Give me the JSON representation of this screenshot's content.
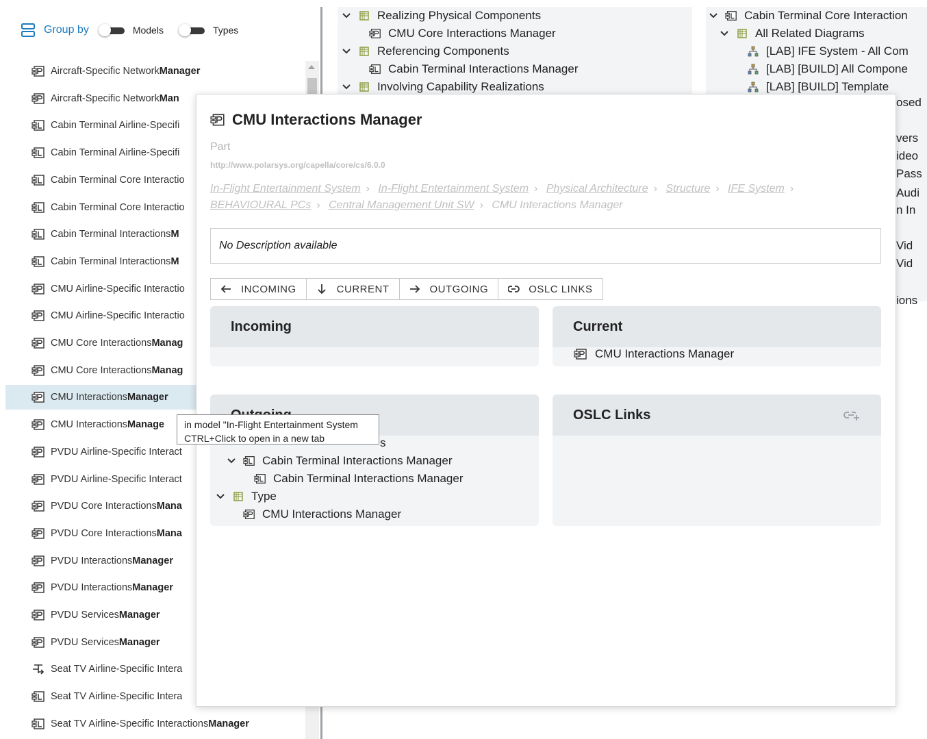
{
  "left_panel": {
    "group_by_label": "Group by",
    "models_label": "Models",
    "types_label": "Types",
    "items": [
      {
        "text": "Aircraft-Specific Network ",
        "bold": "Manager",
        "icon": "physical-component-icon"
      },
      {
        "text": "Aircraft-Specific Network ",
        "bold": "Man",
        "icon": "physical-component-icon"
      },
      {
        "text": "Cabin Terminal Airline-Specifi",
        "bold": "",
        "icon": "logical-component-icon"
      },
      {
        "text": "Cabin Terminal Airline-Specifi",
        "bold": "",
        "icon": "logical-component-icon"
      },
      {
        "text": "Cabin Terminal Core Interactio",
        "bold": "",
        "icon": "logical-component-icon"
      },
      {
        "text": "Cabin Terminal Core Interactio",
        "bold": "",
        "icon": "logical-component-icon"
      },
      {
        "text": "Cabin Terminal Interactions ",
        "bold": "M",
        "icon": "logical-component-icon"
      },
      {
        "text": "Cabin Terminal Interactions ",
        "bold": "M",
        "icon": "logical-component-icon"
      },
      {
        "text": "CMU Airline-Specific Interactio",
        "bold": "",
        "icon": "physical-component-icon"
      },
      {
        "text": "CMU Airline-Specific Interactio",
        "bold": "",
        "icon": "physical-component-icon"
      },
      {
        "text": "CMU Core Interactions ",
        "bold": "Manag",
        "icon": "physical-component-icon"
      },
      {
        "text": "CMU Core Interactions ",
        "bold": "Manag",
        "icon": "physical-component-icon"
      },
      {
        "text": "CMU Interactions ",
        "bold": "Manager",
        "icon": "physical-component-icon",
        "selected": true
      },
      {
        "text": "CMU Interactions ",
        "bold": "Manage",
        "icon": "physical-component-icon"
      },
      {
        "text": "PVDU Airline-Specific Interact",
        "bold": "",
        "icon": "physical-component-icon"
      },
      {
        "text": "PVDU Airline-Specific Interact",
        "bold": "",
        "icon": "physical-component-icon"
      },
      {
        "text": "PVDU Core Interactions ",
        "bold": "Mana",
        "icon": "physical-component-icon"
      },
      {
        "text": "PVDU Core Interactions ",
        "bold": "Mana",
        "icon": "physical-component-icon"
      },
      {
        "text": "PVDU Interactions ",
        "bold": "Manager",
        "icon": "physical-component-icon"
      },
      {
        "text": "PVDU Interactions ",
        "bold": "Manager",
        "icon": "physical-component-icon"
      },
      {
        "text": "PVDU Services ",
        "bold": "Manager",
        "icon": "physical-component-icon"
      },
      {
        "text": "PVDU Services ",
        "bold": "Manager",
        "icon": "physical-component-icon"
      },
      {
        "text": "Seat TV Airline-Specific Intera",
        "bold": "",
        "icon": "function-icon"
      },
      {
        "text": "Seat TV Airline-Specific Intera",
        "bold": "",
        "icon": "logical-component-icon"
      },
      {
        "text": "Seat TV Airline-Specific Interactions ",
        "bold": "Manager",
        "icon": "logical-component-icon"
      }
    ]
  },
  "bg_middle": {
    "lines": [
      {
        "text": "Realizing Physical Components",
        "icon": "package-icon",
        "chevron": true,
        "indent": 0
      },
      {
        "text": "CMU Core Interactions Manager",
        "icon": "physical-component-icon",
        "chevron": false,
        "indent": 1
      },
      {
        "text": "Referencing Components",
        "icon": "package-icon",
        "chevron": true,
        "indent": 0
      },
      {
        "text": "Cabin Terminal Interactions Manager",
        "icon": "logical-component-icon",
        "chevron": false,
        "indent": 1
      },
      {
        "text": "Involving Capability Realizations",
        "icon": "package-icon",
        "chevron": true,
        "indent": 0
      }
    ]
  },
  "bg_right": {
    "lines": [
      {
        "text": "Cabin Terminal Core Interaction",
        "icon": "logical-component-icon",
        "chevron": true,
        "indent": 0
      },
      {
        "text": "All Related Diagrams",
        "icon": "package-icon",
        "chevron": true,
        "indent": 1
      },
      {
        "text": "[LAB] IFE System - All Com",
        "icon": "diagram-icon",
        "chevron": false,
        "indent": 2
      },
      {
        "text": "[LAB] [BUILD] All Compone",
        "icon": "diagram-icon",
        "chevron": false,
        "indent": 2
      },
      {
        "text": "[LAB] [BUILD] Template",
        "icon": "diagram-icon",
        "chevron": false,
        "indent": 2
      }
    ],
    "fragments": [
      "osed",
      "vers",
      "ideo",
      "Pass",
      "Audi",
      "n In",
      "Vid",
      "Vid",
      "ions"
    ]
  },
  "popup": {
    "title": "CMU Interactions Manager",
    "type": "Part",
    "uri": "http://www.polarsys.org/capella/core/cs/6.0.0",
    "breadcrumbs": [
      "In-Flight Entertainment System",
      "In-Flight Entertainment System",
      "Physical Architecture",
      "Structure",
      "IFE System",
      "BEHAVIOURAL PCs",
      "Central Management Unit SW"
    ],
    "breadcrumb_current": "CMU Interactions Manager",
    "breadcrumb_sep": "›",
    "description": "No Description available",
    "tabs": [
      {
        "label": "INCOMING",
        "icon": "arrow-left-icon"
      },
      {
        "label": "CURRENT",
        "icon": "arrow-down-icon"
      },
      {
        "label": "OUTGOING",
        "icon": "arrow-right-icon"
      },
      {
        "label": "OSLC LINKS",
        "icon": "link-icon"
      }
    ],
    "incoming": {
      "title": "Incoming"
    },
    "current": {
      "title": "Current",
      "item": "CMU Interactions Manager"
    },
    "outgoing": {
      "title": "Outgoing",
      "partial_text": "s",
      "lines": [
        {
          "text": "Cabin Terminal Interactions Manager",
          "icon": "logical-component-icon",
          "chevron": true,
          "indent": 1
        },
        {
          "text": "Cabin Terminal Interactions Manager",
          "icon": "logical-component-icon",
          "chevron": false,
          "indent": 2
        },
        {
          "text": "Type",
          "icon": "package-icon",
          "chevron": true,
          "indent": 0
        },
        {
          "text": "CMU Interactions Manager",
          "icon": "physical-component-icon",
          "chevron": false,
          "indent": 1
        }
      ]
    },
    "oslc": {
      "title": "OSLC Links"
    }
  },
  "tooltip": {
    "line1": "in model \"In-Flight Entertainment System",
    "line2": "CTRL+Click to open in a new tab"
  },
  "colors": {
    "accent": "#1a7bc1",
    "selected": "#dbe9f0",
    "package": "#8a9a3a"
  }
}
